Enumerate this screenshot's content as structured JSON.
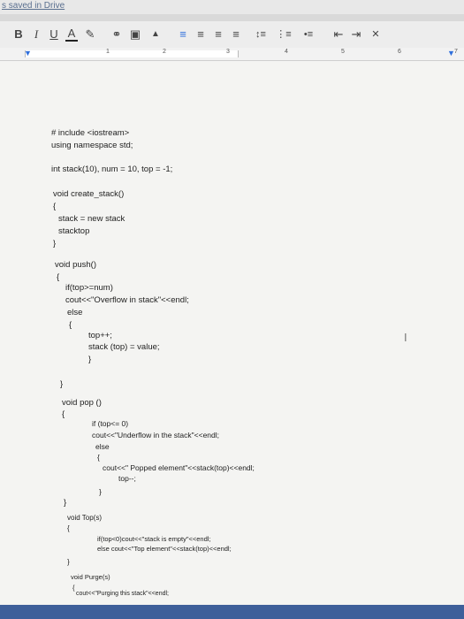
{
  "status": {
    "text": "s saved in Drive"
  },
  "toolbar": {
    "bold": "B",
    "italic": "I",
    "underline": "U",
    "text_color": "A",
    "highlight": "✎",
    "link": "⚭",
    "comment": "▣",
    "image": "▲",
    "align_left": "≡",
    "align_center": "≡",
    "align_right": "≡",
    "justify": "≡",
    "line_spacing": "↕≡",
    "numbered_list": "⋮≡",
    "bullet_list": "•≡",
    "decrease_indent": "⇤",
    "increase_indent": "⇥",
    "clear_format": "✕"
  },
  "ruler": {
    "marks": [
      "1",
      "2",
      "3",
      "4",
      "5",
      "6",
      "7"
    ],
    "indent_marker": "▼"
  },
  "document": {
    "lines": [
      "# include <iostream>",
      "using namespace std;",
      "int stack(10), num = 10, top = -1;",
      "void create_stack()",
      "{",
      "stack = new stack",
      "stacktop",
      "}",
      "void push()",
      "{",
      "if(top>=num)",
      "cout<<\"Overflow in stack\"<<endl;",
      "else",
      "{",
      "top++;",
      "stack (top) = value;",
      "}",
      "}",
      "void pop ()",
      "{",
      "if (top<= 0)",
      "cout<<\"Underflow in the stack\"<<endl;",
      "else",
      "{",
      "cout<<\" Popped element\"<<stack(top)<<endl;",
      "top--;",
      "}",
      "}",
      "void Top(s)",
      "{",
      "if(top<0)cout<<\"stack is empty\"<<endl;",
      "else cout<<\"Top element\"<<stack(top)<<endl;",
      "}",
      "void Purge(s)",
      "{",
      "cout<<\"Purging this stack\"<<endl;"
    ]
  },
  "colors": {
    "taskbar": "#3e5f9a",
    "link_blue": "#2f6fdc"
  }
}
